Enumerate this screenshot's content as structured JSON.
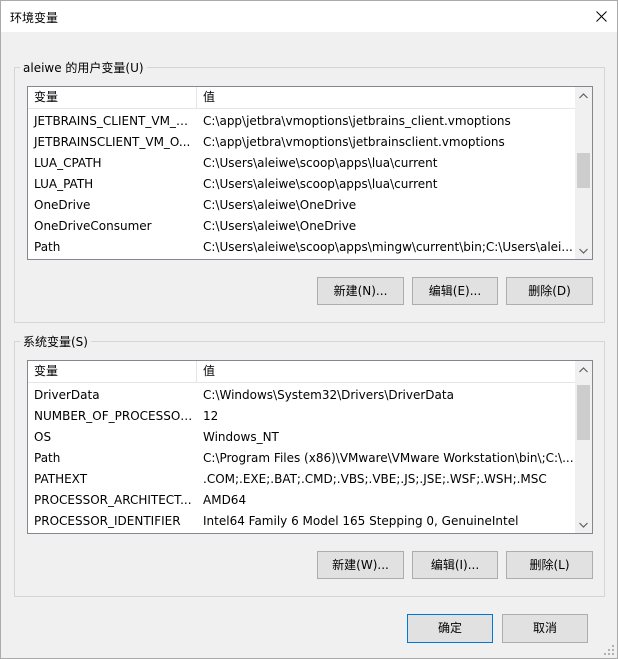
{
  "window": {
    "title": "环境变量"
  },
  "user_group": {
    "label": "aleiwe 的用户变量(U)",
    "columns": [
      "变量",
      "值"
    ],
    "rows": [
      {
        "name": "JETBRAINS_CLIENT_VM_O...",
        "value": "C:\\app\\jetbra\\vmoptions\\jetbrains_client.vmoptions"
      },
      {
        "name": "JETBRAINSCLIENT_VM_O...",
        "value": "C:\\app\\jetbra\\vmoptions\\jetbrainsclient.vmoptions"
      },
      {
        "name": "LUA_CPATH",
        "value": "C:\\Users\\aleiwe\\scoop\\apps\\lua\\current"
      },
      {
        "name": "LUA_PATH",
        "value": "C:\\Users\\aleiwe\\scoop\\apps\\lua\\current"
      },
      {
        "name": "OneDrive",
        "value": "C:\\Users\\aleiwe\\OneDrive"
      },
      {
        "name": "OneDriveConsumer",
        "value": "C:\\Users\\aleiwe\\OneDrive"
      },
      {
        "name": "Path",
        "value": "C:\\Users\\aleiwe\\scoop\\apps\\mingw\\current\\bin;C:\\Users\\alei..."
      }
    ],
    "buttons": {
      "new": "新建(N)...",
      "edit": "编辑(E)...",
      "delete": "删除(D)"
    }
  },
  "system_group": {
    "label": "系统变量(S)",
    "columns": [
      "变量",
      "值"
    ],
    "rows": [
      {
        "name": "DriverData",
        "value": "C:\\Windows\\System32\\Drivers\\DriverData"
      },
      {
        "name": "NUMBER_OF_PROCESSORS",
        "value": "12"
      },
      {
        "name": "OS",
        "value": "Windows_NT"
      },
      {
        "name": "Path",
        "value": "C:\\Program Files (x86)\\VMware\\VMware Workstation\\bin\\;C:\\..."
      },
      {
        "name": "PATHEXT",
        "value": ".COM;.EXE;.BAT;.CMD;.VBS;.VBE;.JS;.JSE;.WSF;.WSH;.MSC"
      },
      {
        "name": "PROCESSOR_ARCHITECT...",
        "value": "AMD64"
      },
      {
        "name": "PROCESSOR_IDENTIFIER",
        "value": "Intel64 Family 6 Model 165 Stepping 0, GenuineIntel"
      }
    ],
    "buttons": {
      "new": "新建(W)...",
      "edit": "编辑(I)...",
      "delete": "删除(L)"
    }
  },
  "footer": {
    "ok": "确定",
    "cancel": "取消"
  }
}
